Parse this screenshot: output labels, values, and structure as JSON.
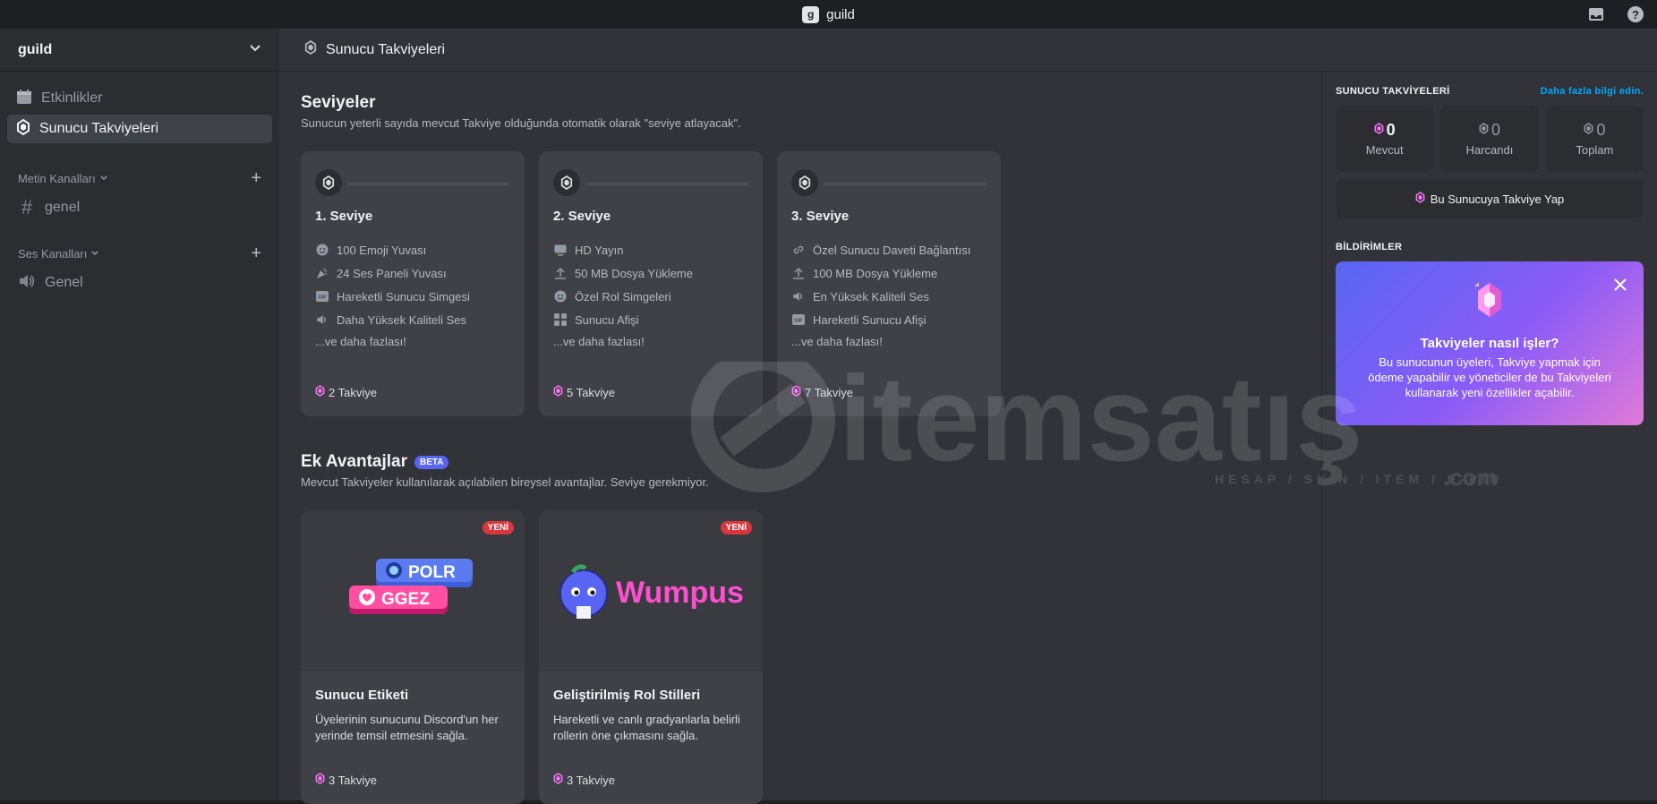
{
  "titlebar": {
    "title": "guild"
  },
  "sidebar": {
    "guild_name": "guild",
    "nav": [
      {
        "label": "Etkinlikler"
      },
      {
        "label": "Sunucu Takviyeleri"
      }
    ],
    "text_category": "Metin Kanalları",
    "text_channels": [
      {
        "label": "genel"
      }
    ],
    "voice_category": "Ses Kanalları",
    "voice_channels": [
      {
        "label": "Genel"
      }
    ]
  },
  "header": {
    "title": "Sunucu Takviyeleri"
  },
  "levels": {
    "title": "Seviyeler",
    "subtitle": "Sunucun yeterli sayıda mevcut Takviye olduğunda otomatik olarak \"seviye atlayacak\".",
    "tiers": [
      {
        "name": "1. Seviye",
        "perks": [
          "100 Emoji Yuvası",
          "24 Ses Paneli Yuvası",
          "Hareketli Sunucu Simgesi",
          "Daha Yüksek Kaliteli Ses"
        ],
        "more": "...ve daha fazlası!",
        "cost": "2 Takviye"
      },
      {
        "name": "2. Seviye",
        "perks": [
          "HD Yayın",
          "50 MB Dosya Yükleme",
          "Özel Rol Simgeleri",
          "Sunucu Afişi"
        ],
        "more": "...ve daha fazlası!",
        "cost": "5 Takviye"
      },
      {
        "name": "3. Seviye",
        "perks": [
          "Özel Sunucu Daveti Bağlantısı",
          "100 MB Dosya Yükleme",
          "En Yüksek Kaliteli Ses",
          "Hareketli Sunucu Afişi"
        ],
        "more": "...ve daha fazlası!",
        "cost": "7 Takviye"
      }
    ]
  },
  "extras": {
    "title": "Ek Avantajlar",
    "beta": "BETA",
    "subtitle": "Mevcut Takviyeler kullanılarak açılabilen bireysel avantajlar. Seviye gerekmiyor.",
    "cards": [
      {
        "badge": "YENİ",
        "tag1": "POLR",
        "tag2": "GGEZ",
        "title": "Sunucu Etiketi",
        "desc": "Üyelerinin sunucunu Discord'un her yerinde temsil etmesini sağla.",
        "cost": "3 Takviye"
      },
      {
        "badge": "YENİ",
        "art_text": "Wumpus",
        "title": "Geliştirilmiş Rol Stilleri",
        "desc": "Hareketli ve canlı gradyanlarla belirli rollerin öne çıkmasını sağla.",
        "cost": "3 Takviye"
      }
    ]
  },
  "right": {
    "title": "SUNUCU TAKVİYELERİ",
    "link": "Daha fazla bilgi edin.",
    "stats": [
      {
        "value": "0",
        "label": "Mevcut"
      },
      {
        "value": "0",
        "label": "Harcandı"
      },
      {
        "value": "0",
        "label": "Toplam"
      }
    ],
    "boost_button": "Bu Sunucuya Takviye Yap",
    "notif_title": "BİLDİRİMLER",
    "notif": {
      "heading": "Takviyeler nasıl işler?",
      "body": "Bu sunucunun üyeleri, Takviye yapmak için ödeme yapabilir ve yöneticiler de bu Takviyeleri kullanarak yeni özellikler açabilir."
    }
  },
  "watermark": {
    "brand": "itemsatış",
    "tagline": "HESAP / SKIN / ITEM / E-PIN",
    "tld": ".com"
  },
  "colors": {
    "accent": "#5865f2",
    "boost_pink": "#ff73fa",
    "new_red": "#da373c"
  }
}
